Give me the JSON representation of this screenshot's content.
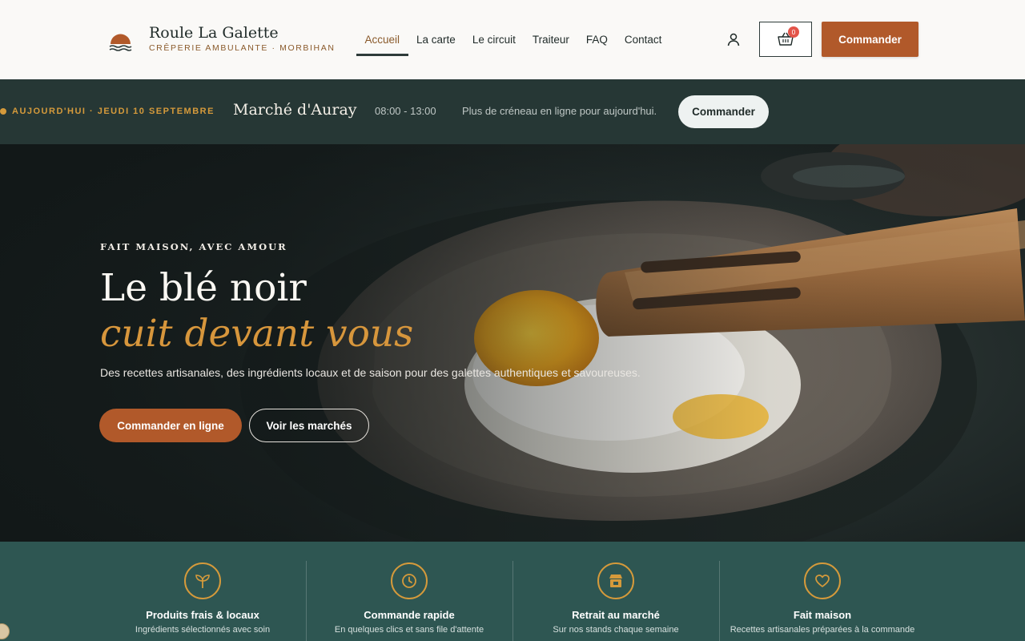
{
  "brand": {
    "name": "Roule La Galette",
    "tagline": "CRÊPERIE AMBULANTE · MORBIHAN",
    "accent": "#b1592a",
    "gold": "#d7963c",
    "dark": "#263735",
    "teal": "#2e5652"
  },
  "nav": {
    "items": [
      {
        "label": "Accueil",
        "active": true
      },
      {
        "label": "La carte"
      },
      {
        "label": "Le circuit"
      },
      {
        "label": "Traiteur"
      },
      {
        "label": "FAQ"
      },
      {
        "label": "Contact"
      }
    ],
    "account_icon": "user-icon",
    "cart_icon": "basket-icon",
    "cart_count": "0",
    "order_label": "Commander"
  },
  "market": {
    "date": "AUJOURD'HUI · JEUDI 10 SEPTEMBRE",
    "place": "Marché d'Auray",
    "hours": "08:00 - 13:00",
    "note": "Plus de créneau en ligne pour aujourd'hui.",
    "order_label": "Commander"
  },
  "hero": {
    "kicker": "FAIT MAISON, AVEC AMOUR",
    "title_line1": "Le blé noir",
    "title_line2": "cuit devant vous",
    "lead": "Des recettes artisanales, des ingrédients locaux et de saison pour des galettes authentiques et savoureuses.",
    "primary_label": "Commander en ligne",
    "secondary_label": "Voir les marchés"
  },
  "features": [
    {
      "icon": "sprout-icon",
      "title": "Produits frais & locaux",
      "text": "Ingrédients sélectionnés avec soin"
    },
    {
      "icon": "clock-icon",
      "title": "Commande rapide",
      "text": "En quelques clics et sans file d'attente"
    },
    {
      "icon": "store-icon",
      "title": "Retrait au marché",
      "text": "Sur nos stands chaque semaine"
    },
    {
      "icon": "heart-icon",
      "title": "Fait maison",
      "text": "Recettes artisanales préparées à la commande"
    }
  ]
}
